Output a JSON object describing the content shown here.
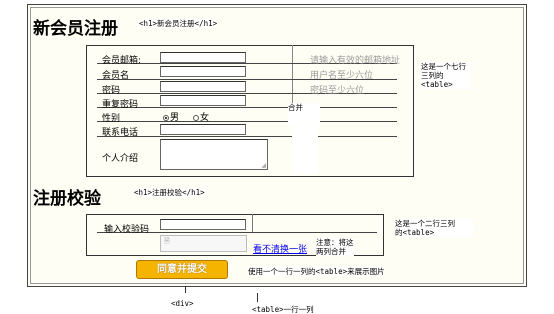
{
  "form": {
    "heading": "新会员注册",
    "fields": [
      {
        "label": "会员邮箱:",
        "hint": "请输入有效的邮箱地址"
      },
      {
        "label": "会员名",
        "hint": "用户名至少六位"
      },
      {
        "label": "密码",
        "hint": "密码至少六位"
      },
      {
        "label": "重复密码",
        "hint": ""
      },
      {
        "label": "性别",
        "hint": ""
      },
      {
        "label": "联系电话",
        "hint": ""
      },
      {
        "label": "个人介绍",
        "hint": ""
      }
    ],
    "gender": {
      "male": "男",
      "female": "女",
      "selected": "男"
    }
  },
  "verify": {
    "heading": "注册校验",
    "label": "输入校验码",
    "refresh_link": "看不清换一张",
    "note": "注意：将这\n两列合并"
  },
  "submit_label": "同意并提交",
  "annotations": {
    "h1_form": "<h1>新会员注册</h1>",
    "h1_verify": "<h1>注册校验</h1>",
    "merge": "合并",
    "table7": "这是一个七行\n三列的\n<table>",
    "table2": "这是一个二行三列\n的<table>",
    "image_table": "使用一个一行一列的<table>来展示图片",
    "div": "<div>",
    "table_single": "<table>一行一列"
  }
}
